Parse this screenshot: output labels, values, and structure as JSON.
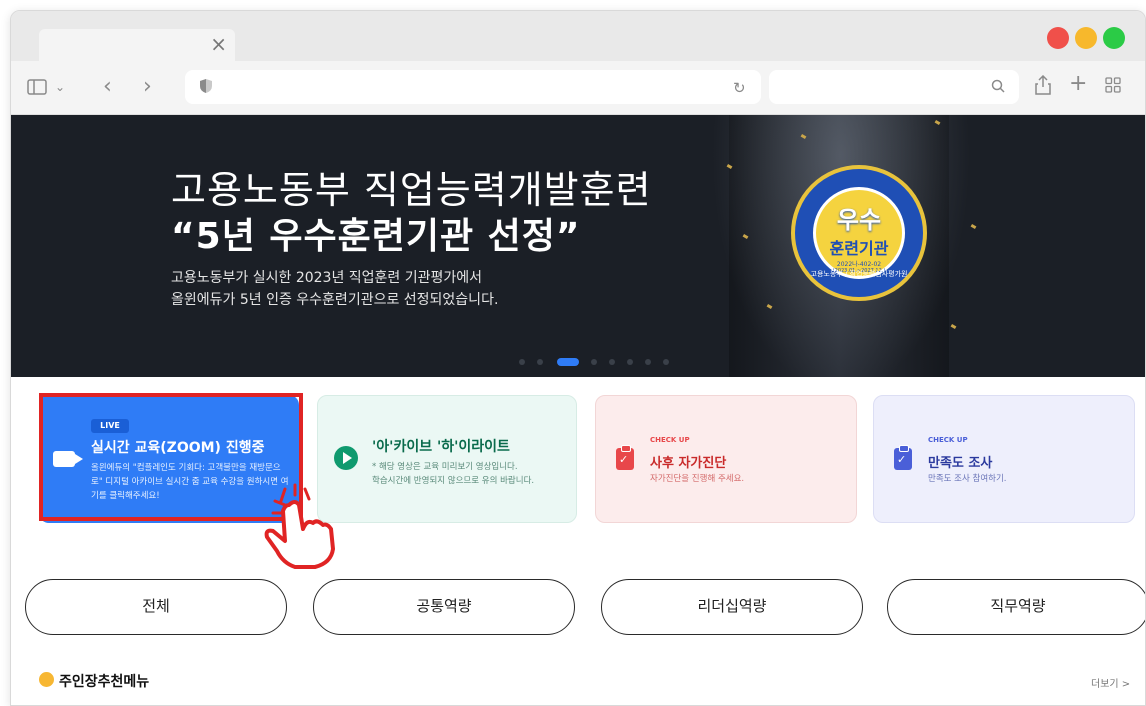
{
  "browser": {
    "tab_close": "×",
    "traffic_colors": [
      "#f0504a",
      "#f7b82c",
      "#2bcb46"
    ],
    "icons": [
      "sidebar-icon",
      "chevron-down-icon",
      "back-icon",
      "forward-icon",
      "shield-icon",
      "reload-icon",
      "search-icon",
      "share-icon",
      "plus-icon",
      "tab-grid-icon"
    ]
  },
  "hero": {
    "title_line1": "고용노동부 직업능력개발훈련",
    "title_line2": "“5년 우수훈련기관 선정”",
    "desc_line1": "고용노동부가 실시한 2023년 직업훈련 기관평가에서",
    "desc_line2": "올윈에듀가 5년 인증 우수훈련기관으로 선정되었습니다.",
    "medal": {
      "line1": "우수",
      "line2": "훈련기관",
      "line3": "2022나-402-02",
      "line4": "(2023.01.~2027.12.)",
      "ring": "고용노동부 / 직업능력심사평가원"
    },
    "slide_count": 8,
    "active_slide": 2
  },
  "cards": {
    "live": {
      "badge": "LIVE",
      "title": "실시간 교육(ZOOM) 진행중",
      "desc": "올윈에듀의 \"컴플레인도 기회다: 고객불만을 재방문으로\" 디지털 아카이브 실시간 줌 교육 수강을 원하시면 여기를 클릭해주세요!"
    },
    "archive": {
      "title": "'아'카이브 '하'이라이트",
      "desc_line1": "* 해당 영상은 교육 미리보기 영상입니다.",
      "desc_line2": "학습시간에 반영되지 않으므로 유의 바랍니다."
    },
    "checkup": {
      "label": "CHECK UP",
      "title": "사후 자가진단",
      "sub": "자가진단을 진행해 주세요."
    },
    "survey": {
      "label": "CHECK UP",
      "title": "만족도 조사",
      "sub": "만족도 조사 참여하기."
    }
  },
  "filters": [
    "전체",
    "공통역량",
    "리더십역량",
    "직무역량"
  ],
  "recommend": {
    "title": "주인장추천메뉴",
    "more": "더보기 >"
  },
  "colors": {
    "accent": "#2f7cf6",
    "hero_bg": "#1b1f26",
    "highlight": "#e02424"
  }
}
